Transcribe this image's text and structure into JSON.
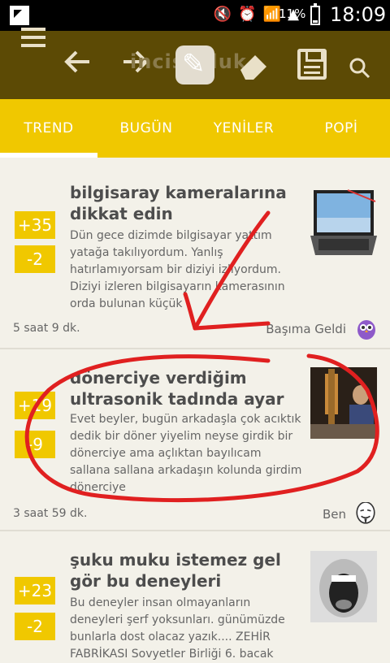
{
  "status_bar": {
    "battery": "11%",
    "time": "18:09"
  },
  "toolbar": {
    "logo": "incisozluk"
  },
  "tabs": [
    "TREND",
    "BUGÜN",
    "YENİLER",
    "POPİ"
  ],
  "entries": [
    {
      "up": "+35",
      "down": "-2",
      "title": "bilgisaray kameralarına dikkat edin",
      "excerpt": "Dün gece dizimde bilgisayar yattım yatağa takılıyordum. Yanlış hatırlamıyorsam bir diziyi izliyordum. Diziyi izleren bilgisayarın kamerasının orda bulunan küçük",
      "time": "5 saat 9 dk.",
      "author": "Başıma Geldi"
    },
    {
      "up": "+19",
      "down": "-9",
      "title": "dönerciye verdiğim ultrasonik tadında ayar",
      "excerpt": "Evet beyler, bugün arkadaşla çok acıktık dedik bir döner yiyelim neyse girdik bir dönerciye ama açlıktan bayılıcam sallana sallana arkadaşın kolunda girdim dönerciye",
      "time": "3 saat 59 dk.",
      "author": "Ben"
    },
    {
      "up": "+23",
      "down": "-2",
      "title": "şuku muku istemez gel gör bu deneyleri",
      "excerpt": "Bu deneyler insan olmayanların deneyleri şerf yoksunları. günümüzde bunlarla dost olacaz yazık.... ZEHİR FABRİKASI Sovyetler Birliği 6. bacak",
      "time": "",
      "author": ""
    }
  ]
}
